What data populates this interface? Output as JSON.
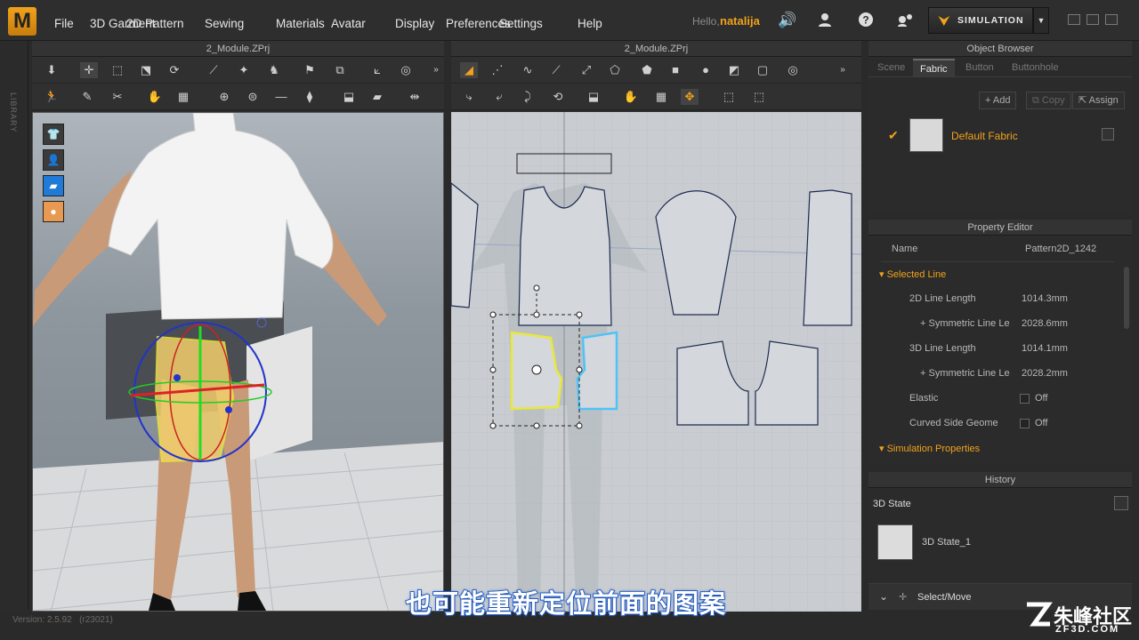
{
  "app": {
    "logo_letter": "M",
    "hello": "Hello,",
    "username": "natalija",
    "version": "Version: 2.5.92",
    "build": "(r23021)"
  },
  "menu": [
    "File",
    "3D Garment",
    "2D Pattern",
    "Sewing",
    "Materials",
    "Avatar",
    "Display",
    "Preferences",
    "Settings",
    "Help"
  ],
  "simulation": {
    "label": "SIMULATION",
    "dropdown_icon": "caret-down-icon"
  },
  "top_icons": [
    "speaker-icon",
    "user-icon",
    "help-icon",
    "network-icon"
  ],
  "library_label": "LIBRARY",
  "view3d": {
    "title": "2_Module.ZPrj",
    "side_icons": [
      "garment-icon",
      "avatar-icon",
      "fabric-icon",
      "skin-icon"
    ]
  },
  "view2d": {
    "title": "2_Module.ZPrj"
  },
  "object_browser": {
    "title": "Object Browser",
    "tabs": [
      "Scene",
      "Fabric",
      "Button",
      "Buttonhole"
    ],
    "active_tab": "Fabric",
    "add_label": "Add",
    "copy_label": "Copy",
    "assign_label": "Assign",
    "fabric_name": "Default Fabric"
  },
  "property_editor": {
    "title": "Property Editor",
    "name_label": "Name",
    "name_value": "Pattern2D_1242",
    "section_selected_line": "Selected Line",
    "line_2d_label": "2D Line Length",
    "line_2d_value": "1014.3mm",
    "sym_2d_label": "+ Symmetric Line Le",
    "sym_2d_value": "2028.6mm",
    "line_3d_label": "3D Line Length",
    "line_3d_value": "1014.1mm",
    "sym_3d_label": "+ Symmetric Line Le",
    "sym_3d_value": "2028.2mm",
    "elastic_label": "Elastic",
    "elastic_value": "Off",
    "curved_label": "Curved Side Geome",
    "curved_value": "Off",
    "section_simulation": "Simulation Properties"
  },
  "history": {
    "title": "History",
    "state_label": "3D State",
    "item_label": "3D State_1",
    "bottom_label": "Select/Move"
  },
  "subtitle": "也可能重新定位前面的图案",
  "watermark": {
    "text": "朱峰社区",
    "site": "ZF3D.COM"
  },
  "colors": {
    "accent": "#f2a21a",
    "selection_yellow": "#e8e83a",
    "selection_blue": "#4fc3f7",
    "subtitle_stroke": "#2d6bd8"
  }
}
